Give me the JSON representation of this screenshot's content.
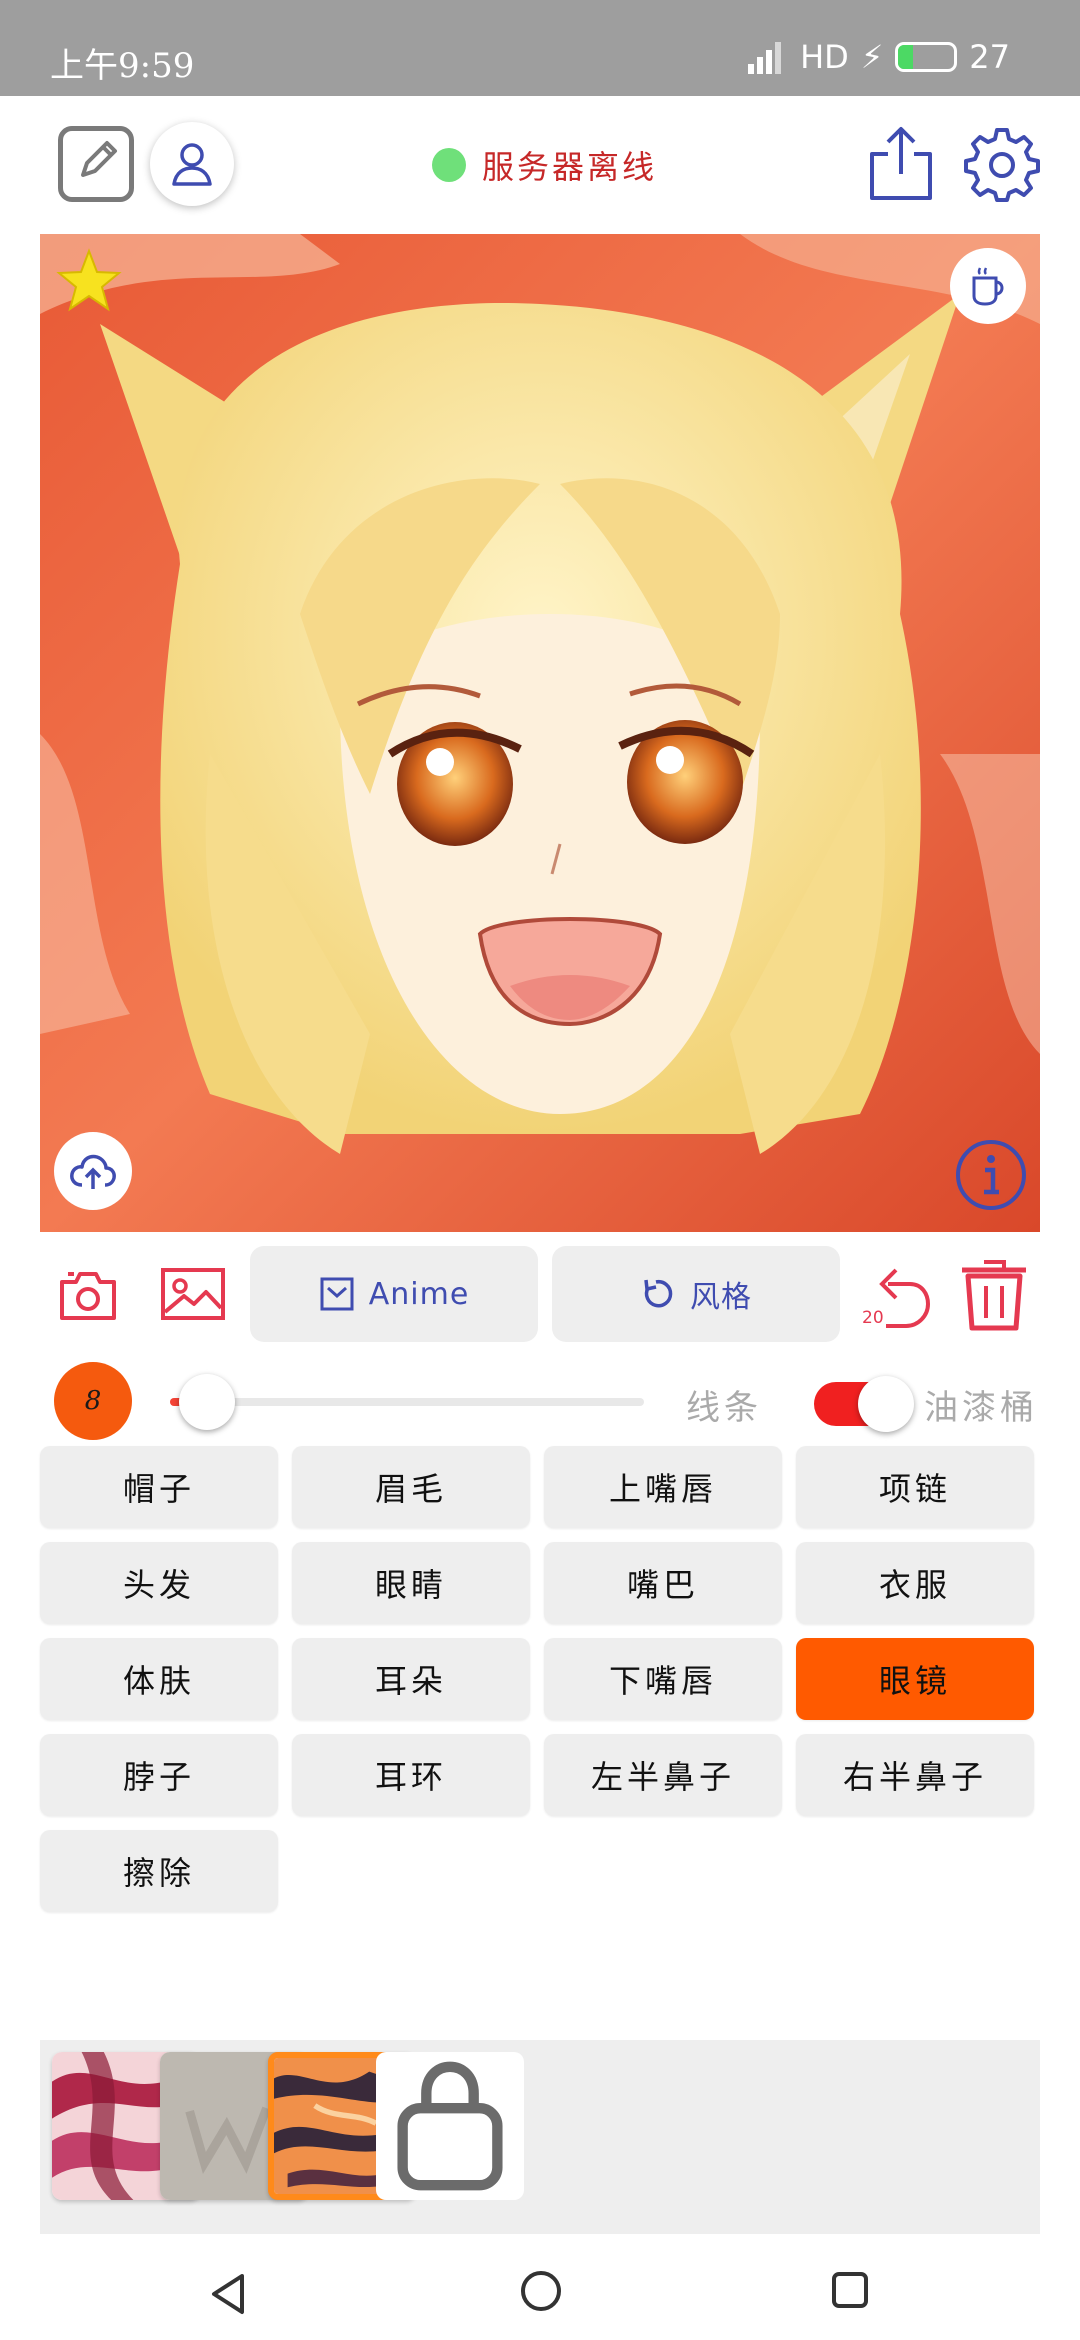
{
  "status_bar": {
    "time": "上午9:59",
    "network": "HD",
    "battery": "27",
    "battery_level": 0.27
  },
  "header": {
    "edit_icon": "pencil-square-icon",
    "user_icon": "user-icon",
    "server_status": "服务器离线",
    "server_status_color": "#6fe07a",
    "share_icon": "share-icon",
    "settings_icon": "gear-icon"
  },
  "canvas": {
    "favorite_icon": "star-icon",
    "coffee_icon": "coffee-cup-icon",
    "upload_icon": "cloud-upload-icon",
    "info_icon": "info-icon"
  },
  "toolbar": {
    "camera_icon": "camera-icon",
    "gallery_icon": "image-icon",
    "anime_label": "Anime",
    "style_label": "风格",
    "undo_count": "20",
    "undo_icon": "undo-icon",
    "delete_icon": "trash-icon",
    "accent": "#e53950"
  },
  "brush": {
    "size": "8",
    "size_fraction": 0.04,
    "lines_label": "线条",
    "paint_bucket_enabled": true,
    "paint_bucket_label": "油漆桶",
    "brush_color": "#f55a0e"
  },
  "parts": [
    {
      "label": "帽子",
      "active": false
    },
    {
      "label": "眉毛",
      "active": false
    },
    {
      "label": "上嘴唇",
      "active": false
    },
    {
      "label": "项链",
      "active": false
    },
    {
      "label": "头发",
      "active": false
    },
    {
      "label": "眼睛",
      "active": false
    },
    {
      "label": "嘴巴",
      "active": false
    },
    {
      "label": "衣服",
      "active": false
    },
    {
      "label": "体肤",
      "active": false
    },
    {
      "label": "耳朵",
      "active": false
    },
    {
      "label": "下嘴唇",
      "active": false
    },
    {
      "label": "眼镜",
      "active": true
    },
    {
      "label": "脖子",
      "active": false
    },
    {
      "label": "耳环",
      "active": false
    },
    {
      "label": "左半鼻子",
      "active": false
    },
    {
      "label": "右半鼻子",
      "active": false
    },
    {
      "label": "擦除",
      "active": false
    }
  ],
  "style_tiles": [
    {
      "name": "red-swirl-style",
      "selected": false
    },
    {
      "name": "gray-sketch-style",
      "selected": false
    },
    {
      "name": "orange-tiger-style",
      "selected": true
    },
    {
      "name": "lock-icon",
      "selected": false
    }
  ],
  "nav": {
    "back_icon": "back-triangle-icon",
    "home_icon": "home-circle-icon",
    "recent_icon": "recent-square-icon"
  }
}
